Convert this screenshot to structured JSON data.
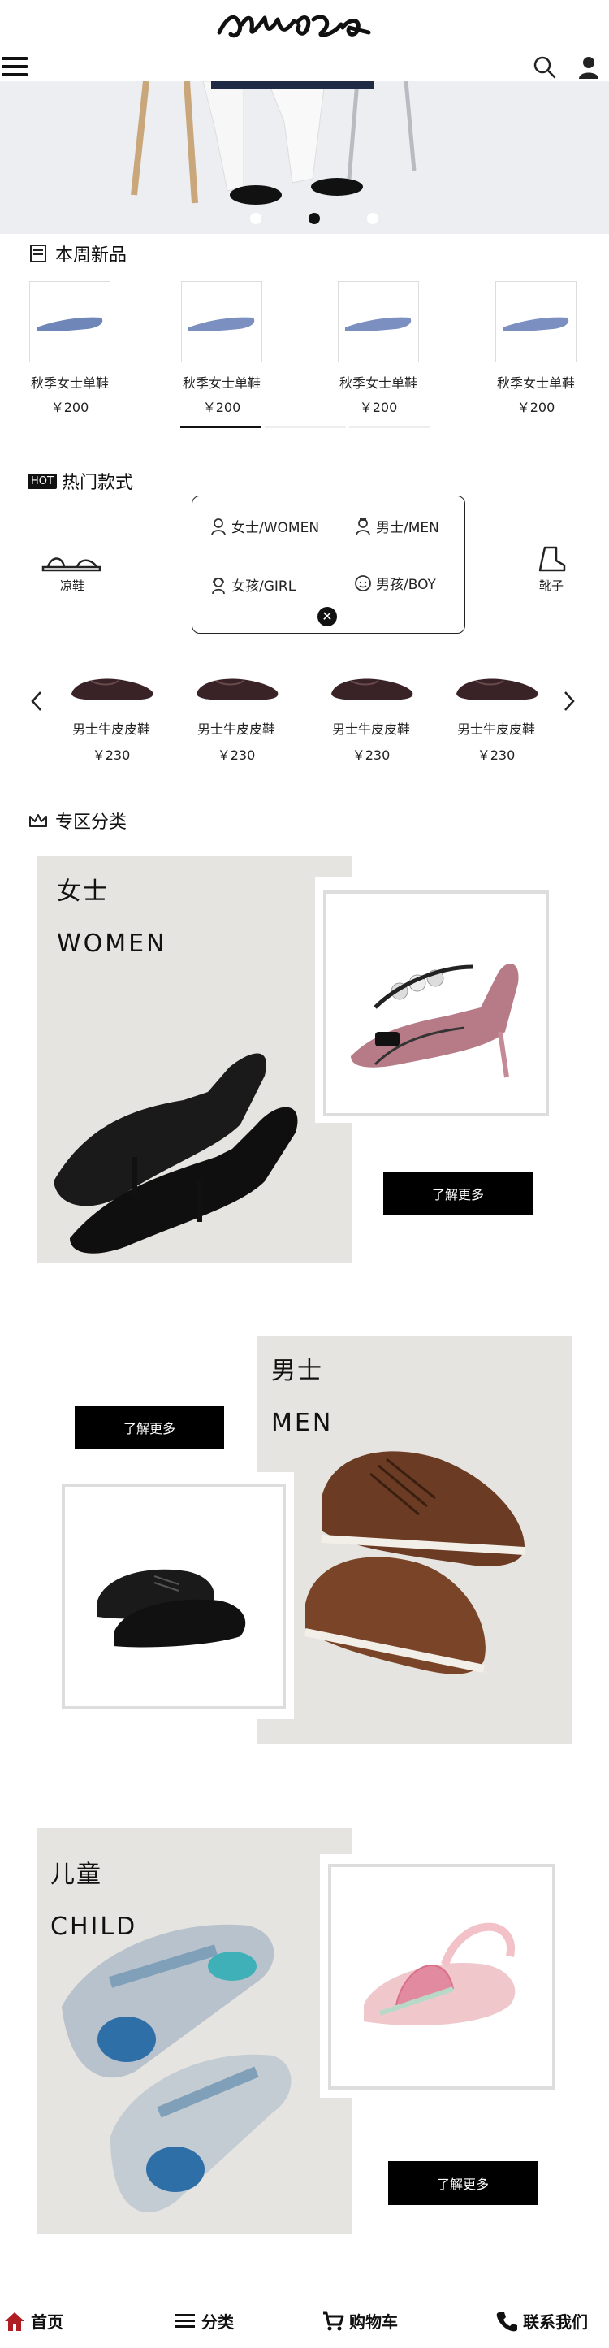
{
  "header": {
    "logo_alt": "logo",
    "menu_icon": "hamburger-icon",
    "search_icon": "search-icon",
    "user_icon": "user-icon"
  },
  "banner": {
    "slides": 3,
    "active_slide": 1
  },
  "new_products": {
    "title": "本周新品",
    "items": [
      {
        "name": "秋季女士单鞋",
        "price": "￥200"
      },
      {
        "name": "秋季女士单鞋",
        "price": "￥200"
      },
      {
        "name": "秋季女士单鞋",
        "price": "￥200"
      },
      {
        "name": "秋季女士单鞋",
        "price": "￥200"
      }
    ]
  },
  "hot": {
    "badge": "HOT",
    "title": "热门款式",
    "categories": [
      {
        "label": "凉鞋"
      },
      {
        "label": "靴子"
      }
    ],
    "popup": {
      "women": "女士/WOMEN",
      "men": "男士/MEN",
      "girl": "女孩/GIRL",
      "boy": "男孩/BOY",
      "close": "✕"
    },
    "men_items": [
      {
        "name": "男士牛皮皮鞋",
        "price": "￥230"
      },
      {
        "name": "男士牛皮皮鞋",
        "price": "￥230"
      },
      {
        "name": "男士牛皮皮鞋",
        "price": "￥230"
      },
      {
        "name": "男士牛皮皮鞋",
        "price": "￥230"
      }
    ]
  },
  "zones": {
    "title": "专区分类",
    "women": {
      "cn": "女士",
      "en": "WOMEN",
      "button": "了解更多"
    },
    "men": {
      "cn": "男士",
      "en": "MEN",
      "button": "了解更多"
    },
    "child": {
      "cn": "儿童",
      "en": "CHILD",
      "button": "了解更多"
    }
  },
  "bottom_nav": {
    "home": "首页",
    "category": "分类",
    "cart": "购物车",
    "contact": "联系我们"
  },
  "colors": {
    "accent": "#c0302a",
    "black": "#000000",
    "frame": "#dddddd",
    "zone_bg": "#e4e2df"
  }
}
